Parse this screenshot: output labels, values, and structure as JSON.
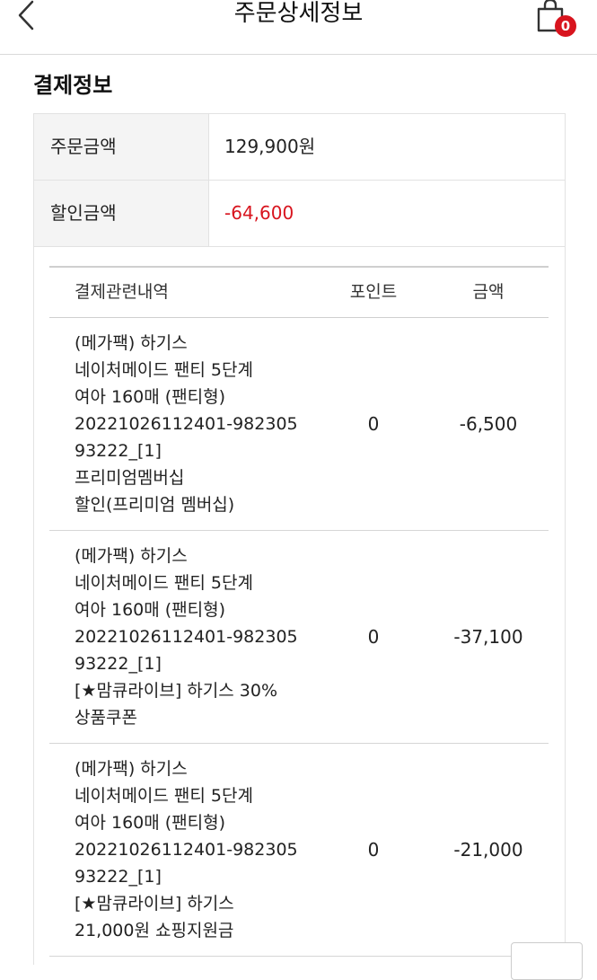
{
  "header": {
    "title": "주문상세정보",
    "cart_count": "0"
  },
  "payment_info": {
    "title": "결제정보",
    "rows": [
      {
        "label": "주문금액",
        "value": "129,900원"
      },
      {
        "label": "할인금액",
        "value": "-64,600"
      }
    ]
  },
  "details": {
    "columns": [
      "결제관련내역",
      "포인트",
      "금액"
    ],
    "rows": [
      {
        "desc": [
          "(메가팩) 하기스",
          "네이처메이드 팬티 5단계",
          "여아 160매 (팬티형)",
          "20221026112401-982305",
          "93222_[1]",
          "프리미엄멤버십",
          "할인(프리미엄 멤버십)"
        ],
        "point": "0",
        "amount": "-6,500"
      },
      {
        "desc": [
          "(메가팩) 하기스",
          "네이처메이드 팬티 5단계",
          "여아 160매 (팬티형)",
          "20221026112401-982305",
          "93222_[1]",
          "[★맘큐라이브] 하기스 30%",
          "상품쿠폰"
        ],
        "point": "0",
        "amount": "-37,100"
      },
      {
        "desc": [
          "(메가팩) 하기스",
          "네이처메이드 팬티 5단계",
          "여아 160매 (팬티형)",
          "20221026112401-982305",
          "93222_[1]",
          "[★맘큐라이브] 하기스",
          "21,000원 쇼핑지원금"
        ],
        "point": "0",
        "amount": "-21,000"
      }
    ]
  },
  "colors": {
    "accent": "#d8141e",
    "label_bg": "#f4f4f4",
    "border": "#e2e2e2"
  },
  "icons": [
    "chevron-left-icon",
    "shopping-bag-icon"
  ]
}
